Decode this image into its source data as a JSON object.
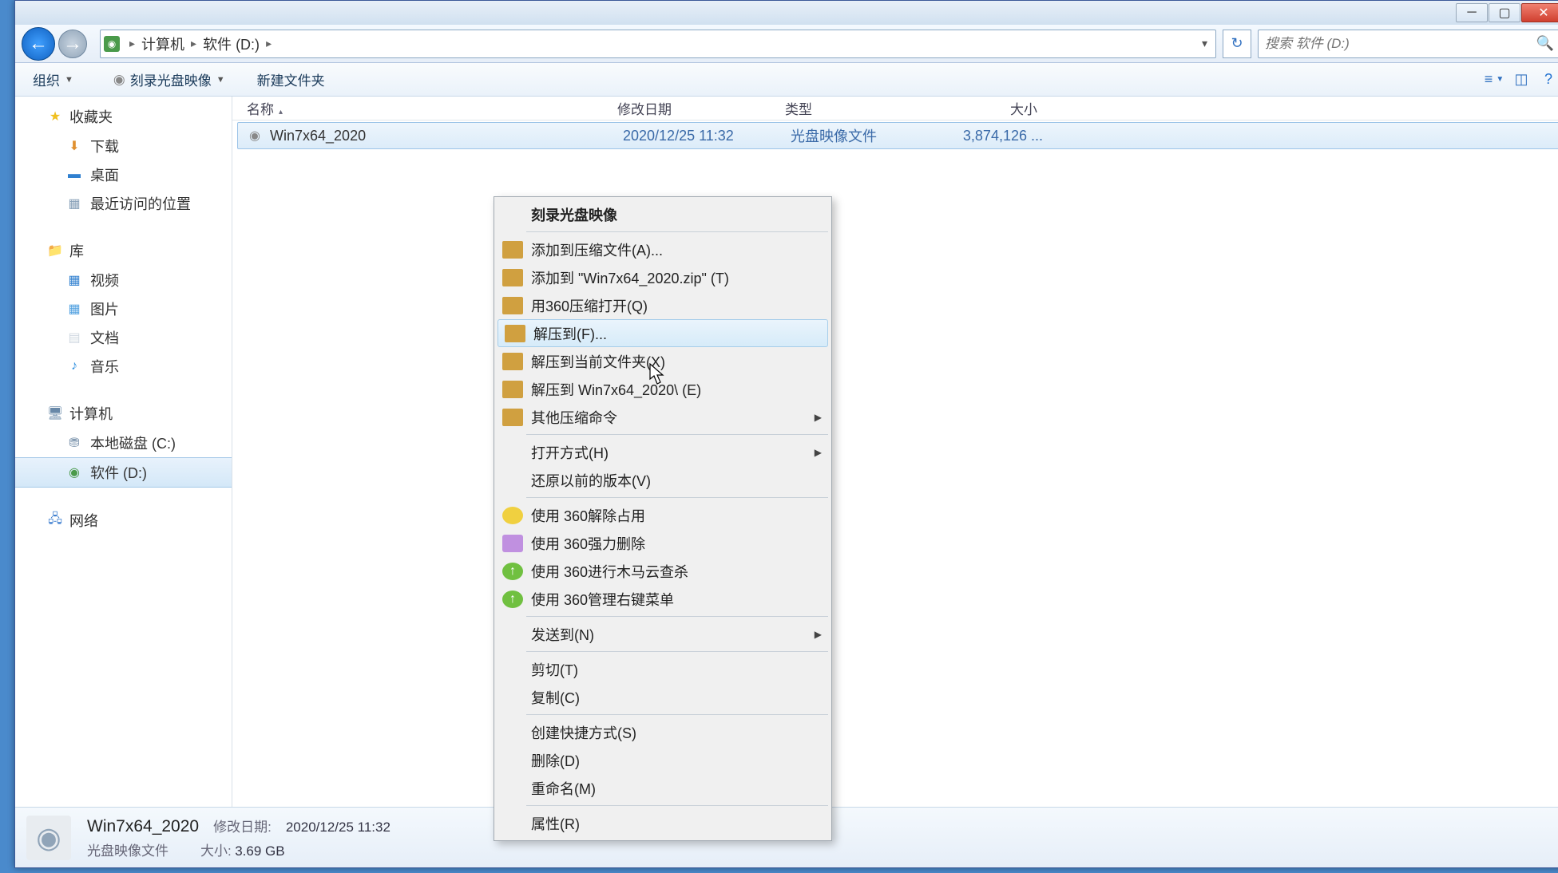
{
  "breadcrumb": {
    "computer": "计算机",
    "location": "软件 (D:)"
  },
  "search": {
    "placeholder": "搜索 软件 (D:)"
  },
  "toolbar": {
    "organize": "组织",
    "burn": "刻录光盘映像",
    "newfolder": "新建文件夹"
  },
  "columns": {
    "name": "名称",
    "date": "修改日期",
    "type": "类型",
    "size": "大小"
  },
  "sidebar": {
    "favorites": "收藏夹",
    "downloads": "下载",
    "desktop": "桌面",
    "recent": "最近访问的位置",
    "libraries": "库",
    "video": "视频",
    "pictures": "图片",
    "documents": "文档",
    "music": "音乐",
    "computer": "计算机",
    "localdisk": "本地磁盘 (C:)",
    "software": "软件 (D:)",
    "network": "网络"
  },
  "file": {
    "name": "Win7x64_2020",
    "date": "2020/12/25 11:32",
    "type": "光盘映像文件",
    "size": "3,874,126 ..."
  },
  "contextmenu": {
    "burn": "刻录光盘映像",
    "addarchive": "添加到压缩文件(A)...",
    "addzip": "添加到 \"Win7x64_2020.zip\" (T)",
    "open360": "用360压缩打开(Q)",
    "extractto": "解压到(F)...",
    "extracthere": "解压到当前文件夹(X)",
    "extractfolder": "解压到 Win7x64_2020\\ (E)",
    "othercompress": "其他压缩命令",
    "openwith": "打开方式(H)",
    "restore": "还原以前的版本(V)",
    "unlock360": "使用 360解除占用",
    "forcedel360": "使用 360强力删除",
    "trojan360": "使用 360进行木马云查杀",
    "manage360": "使用 360管理右键菜单",
    "sendto": "发送到(N)",
    "cut": "剪切(T)",
    "copy": "复制(C)",
    "shortcut": "创建快捷方式(S)",
    "delete": "删除(D)",
    "rename": "重命名(M)",
    "properties": "属性(R)"
  },
  "statusbar": {
    "filename": "Win7x64_2020",
    "datelabel": "修改日期:",
    "dateval": "2020/12/25 11:32",
    "typeval": "光盘映像文件",
    "sizelabel": "大小:",
    "sizeval": "3.69 GB"
  }
}
